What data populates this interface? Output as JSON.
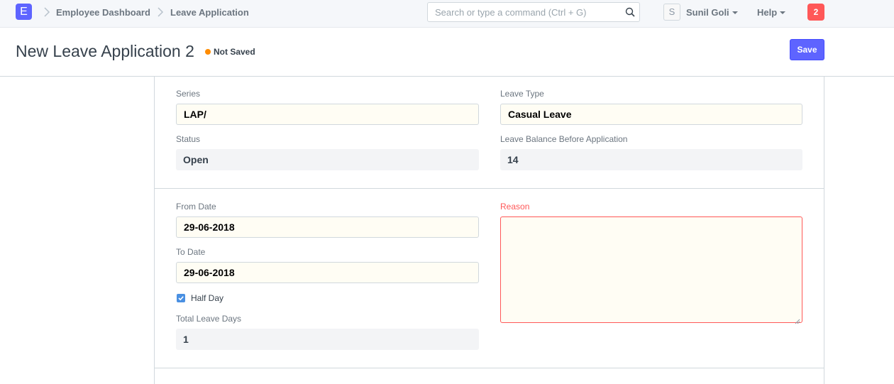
{
  "navbar": {
    "logo_letter": "E",
    "breadcrumbs": [
      "Employee Dashboard",
      "Leave Application"
    ],
    "search_placeholder": "Search or type a command (Ctrl + G)",
    "avatar_letter": "S",
    "user_name": "Sunil Goli",
    "help_label": "Help",
    "notification_count": "2"
  },
  "page": {
    "title": "New Leave Application 2",
    "status": "Not Saved",
    "save_label": "Save"
  },
  "form": {
    "series": {
      "label": "Series",
      "value": "LAP/"
    },
    "leave_type": {
      "label": "Leave Type",
      "value": "Casual Leave"
    },
    "status": {
      "label": "Status",
      "value": "Open"
    },
    "leave_balance": {
      "label": "Leave Balance Before Application",
      "value": "14"
    },
    "from_date": {
      "label": "From Date",
      "value": "29-06-2018"
    },
    "to_date": {
      "label": "To Date",
      "value": "29-06-2018"
    },
    "half_day": {
      "label": "Half Day",
      "checked": true
    },
    "total_leave_days": {
      "label": "Total Leave Days",
      "value": "1"
    },
    "reason": {
      "label": "Reason",
      "value": ""
    }
  },
  "colors": {
    "primary": "#5e64ff",
    "required": "#ff5858",
    "not_saved_indicator": "#ff8c00",
    "checkbox": "#4a90e2"
  }
}
